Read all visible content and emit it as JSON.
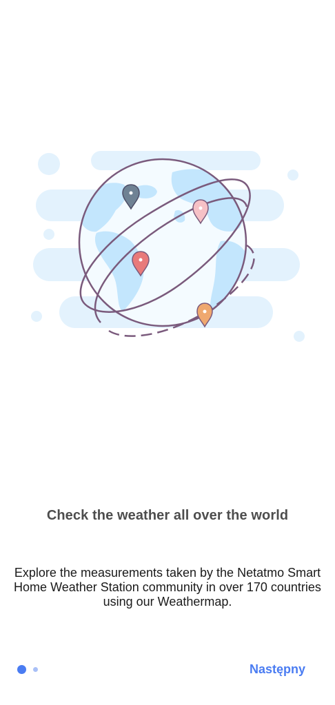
{
  "onboarding": {
    "title": "Check the weather all over the world",
    "description": "Explore the measurements taken by the Netatmo Smart Home Weather Station community in over 170 countries using our Weathermap.",
    "illustration": {
      "icon": "globe-with-pins-icon",
      "colors": {
        "cloud": "#e3f2fd",
        "ocean": "#f4fbff",
        "land": "#c3e6fd",
        "outline": "#7a5a7c",
        "pin_grey": "#6f8294",
        "pin_pink": "#f6c1c6",
        "pin_red": "#e87a7a",
        "pin_orange": "#efa86f"
      }
    }
  },
  "pager": {
    "page_count": 2,
    "current_page": 1,
    "colors": {
      "active": "#4a7cf2",
      "inactive": "#a9c0f7"
    }
  },
  "footer": {
    "next_label": "Następny",
    "accent_color": "#4a7cf2"
  }
}
